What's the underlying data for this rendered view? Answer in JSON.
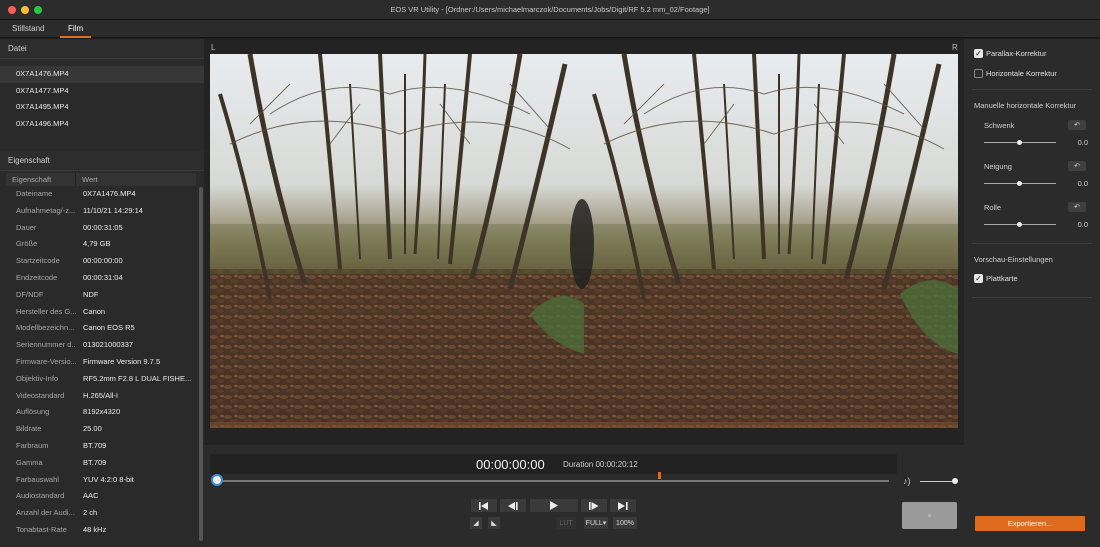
{
  "window": {
    "title": "EOS VR Utility - [Ordner:/Users/michaelmarczok/Documents/Jobs/Digit/RF 5.2 mm_02/Footage]"
  },
  "tabs": [
    {
      "label": "Stillstand"
    },
    {
      "label": "Film"
    }
  ],
  "files": {
    "header": "Datei",
    "items": [
      "0X7A1476.MP4",
      "0X7A1477.MP4",
      "0X7A1495.MP4",
      "0X7A1496.MP4"
    ]
  },
  "properties": {
    "header": "Eigenschaft",
    "col_key": "Eigenschaft",
    "col_value": "Wert",
    "rows": [
      {
        "k": "Dateiname",
        "v": "0X7A1476.MP4"
      },
      {
        "k": "Aufnahmetag/-z...",
        "v": "11/10/21 14:29:14"
      },
      {
        "k": "Dauer",
        "v": "00:00:31:05"
      },
      {
        "k": "Größe",
        "v": "4,79 GB"
      },
      {
        "k": "Startzeitcode",
        "v": "00:00:00:00"
      },
      {
        "k": "Endzeitcode",
        "v": "00:00:31:04"
      },
      {
        "k": "DF/NDF",
        "v": "NDF"
      },
      {
        "k": "Hersteller des G...",
        "v": "Canon"
      },
      {
        "k": "Modellbezeichn...",
        "v": "Canon EOS R5"
      },
      {
        "k": "Seriennummer d...",
        "v": "013021000337"
      },
      {
        "k": "Firmware-Versio...",
        "v": "Firmware Version 9.7.5"
      },
      {
        "k": "Objektiv-Info",
        "v": "RF5.2mm F2.8 L DUAL FISHE..."
      },
      {
        "k": "Videostandard",
        "v": "H.265/All-I"
      },
      {
        "k": "Auflösung",
        "v": "8192x4320"
      },
      {
        "k": "Bildrate",
        "v": "25.00"
      },
      {
        "k": "Farbraum",
        "v": "BT.709"
      },
      {
        "k": "Gamma",
        "v": "BT.709"
      },
      {
        "k": "Farbauswahl",
        "v": "YUV 4:2:0 8-bit"
      },
      {
        "k": "Audiostandard",
        "v": "AAC"
      },
      {
        "k": "Anzahl der Audi...",
        "v": "2 ch"
      },
      {
        "k": "Tonabtast-Rate",
        "v": "48 kHz"
      }
    ]
  },
  "viewer": {
    "left_label": "L",
    "right_label": "R"
  },
  "playback": {
    "timecode": "00:00:00:00",
    "duration": "Duration 00:00:20:12",
    "lut_label": "LUT",
    "size_label": "FULL▾",
    "zoom_label": "100%",
    "position_fraction": 0.0,
    "volume_fraction": 1.0
  },
  "correction": {
    "parallax": {
      "label": "Parallax-Korrektur",
      "checked": true
    },
    "horizontal": {
      "label": "Horizontale Korrektur",
      "checked": false
    },
    "manual_title": "Manuelle horizontale Korrektur",
    "controls": [
      {
        "label": "Schwenk",
        "value": "0.0"
      },
      {
        "label": "Neigung",
        "value": "0.0"
      },
      {
        "label": "Rolle",
        "value": "0.0"
      }
    ]
  },
  "preview": {
    "title": "Vorschau-Einstellungen",
    "plattkarte": {
      "label": "Plattkarte",
      "checked": true
    }
  },
  "export": {
    "label": "Exportieren..."
  },
  "colors": {
    "accent": "#e06a1b",
    "seek_knob_ring": "#3a8fd6"
  }
}
